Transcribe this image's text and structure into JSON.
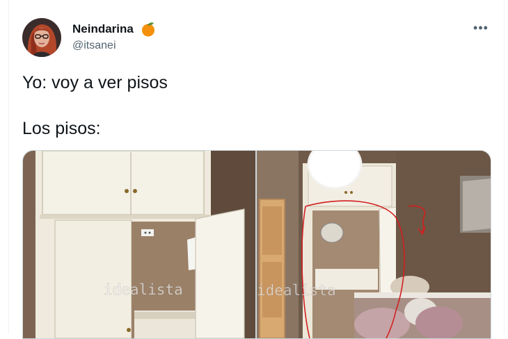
{
  "tweet": {
    "author_name": "Neindarina",
    "author_emoji": "tangerine-emoji",
    "author_handle": "@itsanei",
    "more_label": "•••",
    "lines": [
      "Yo: voy a ver pisos",
      "Los pisos:"
    ]
  },
  "media": {
    "photos": [
      {
        "watermark": "idealista",
        "subject": "wardrobe-closet-photo"
      },
      {
        "watermark": "idealista",
        "subject": "room-with-circled-closet-photo"
      }
    ]
  },
  "colors": {
    "text": "#0f1419",
    "secondary": "#536471",
    "border": "#cfd9de",
    "annotation": "#d11f1f",
    "tangerine": "#f4900c"
  }
}
